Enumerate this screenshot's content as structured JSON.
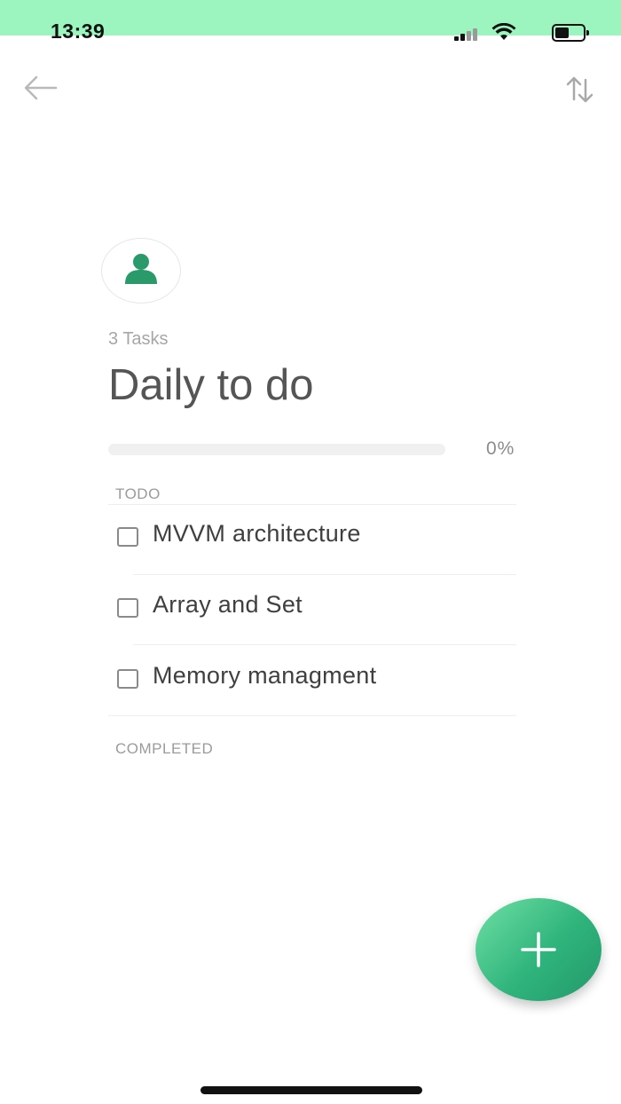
{
  "status_bar": {
    "time": "13:39"
  },
  "header": {
    "back_icon": "arrow-left-icon",
    "sort_icon": "sort-arrows-icon"
  },
  "list": {
    "avatar_icon": "person-icon",
    "task_count": "3 Tasks",
    "title": "Daily to do",
    "progress_fraction": 0,
    "progress_label": "0%"
  },
  "sections": {
    "todo_label": "TODO",
    "completed_label": "COMPLETED"
  },
  "tasks": [
    {
      "label": "MVVM architecture",
      "checked": false
    },
    {
      "label": "Array and Set",
      "checked": false
    },
    {
      "label": "Memory managment",
      "checked": false
    }
  ],
  "fab": {
    "icon": "plus-icon"
  },
  "colors": {
    "status_bar_bg": "#9cf5be",
    "accent_green": "#2fb47c",
    "avatar_green": "#2a9a6a"
  }
}
